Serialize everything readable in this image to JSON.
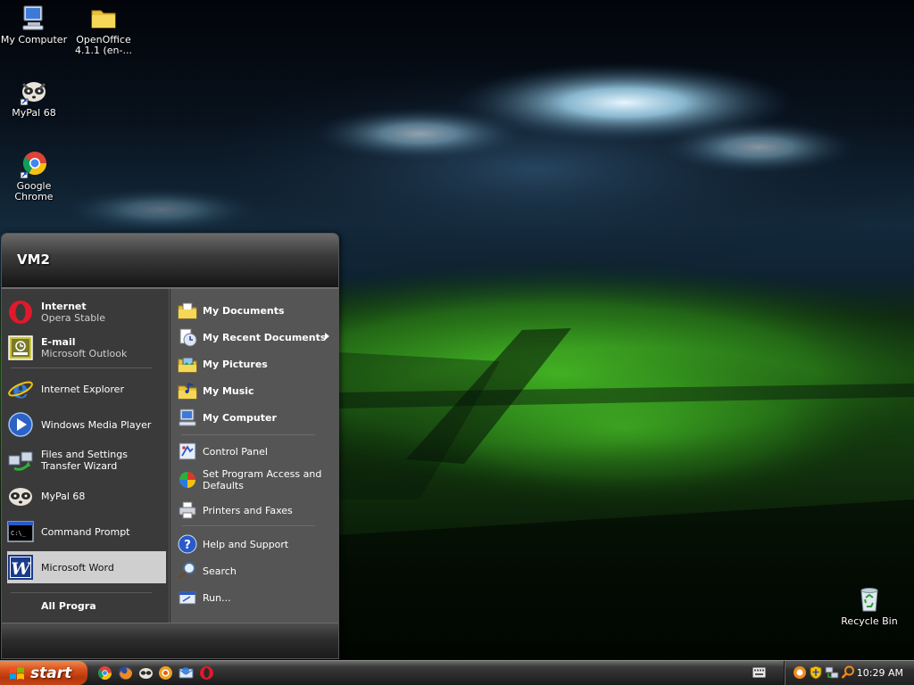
{
  "desktop": {
    "icons": [
      {
        "label": "My Computer",
        "icon": "my-computer-icon"
      },
      {
        "label": "OpenOffice 4.1.1 (en-...",
        "icon": "folder-icon"
      },
      {
        "label": "MyPal 68",
        "icon": "mypal-icon"
      },
      {
        "label": "Google Chrome",
        "icon": "chrome-icon"
      },
      {
        "label": "Recycle Bin",
        "icon": "recycle-bin-icon"
      }
    ]
  },
  "start_menu": {
    "user_name": "VM2",
    "pinned": [
      {
        "title": "Internet",
        "subtitle": "Opera Stable",
        "icon": "opera-icon"
      },
      {
        "title": "E-mail",
        "subtitle": "Microsoft Outlook",
        "icon": "outlook-icon"
      }
    ],
    "recent": [
      {
        "title": "Internet Explorer",
        "icon": "ie-icon"
      },
      {
        "title": "Windows Media Player",
        "icon": "media-player-icon"
      },
      {
        "title": "Files and Settings Transfer Wizard",
        "icon": "transfer-wizard-icon"
      },
      {
        "title": "MyPal 68",
        "icon": "mypal-icon"
      },
      {
        "title": "Command Prompt",
        "icon": "command-prompt-icon"
      },
      {
        "title": "Microsoft Word",
        "icon": "word-icon",
        "selected": true
      }
    ],
    "all_programs_label": "All Progra",
    "places": [
      {
        "label": "My Documents",
        "icon": "my-documents-icon"
      },
      {
        "label": "My Recent Documents",
        "icon": "recent-documents-icon",
        "has_submenu": true
      },
      {
        "label": "My Pictures",
        "icon": "my-pictures-icon"
      },
      {
        "label": "My Music",
        "icon": "my-music-icon"
      },
      {
        "label": "My Computer",
        "icon": "my-computer-icon"
      }
    ],
    "system": [
      {
        "label": "Control Panel",
        "icon": "control-panel-icon"
      },
      {
        "label": "Set Program Access and Defaults",
        "icon": "program-access-icon"
      },
      {
        "label": "Printers and Faxes",
        "icon": "printer-icon"
      }
    ],
    "help": [
      {
        "label": "Help and Support",
        "icon": "help-icon"
      },
      {
        "label": "Search",
        "icon": "search-icon"
      },
      {
        "label": "Run...",
        "icon": "run-icon"
      }
    ]
  },
  "taskbar": {
    "start_label": "start",
    "quick_launch": [
      "chrome-icon",
      "firefox-icon",
      "mypal-icon",
      "waterfox-icon",
      "thunderbird-icon",
      "opera-icon"
    ],
    "tray_icons": [
      "language-keyboard-icon",
      "avast-icon",
      "security-shield-icon",
      "network-icon",
      "search-tray-icon"
    ],
    "clock": "10:29 AM"
  },
  "colors": {
    "start_button": "#d9531e",
    "menu_left": "#3a3a3a",
    "menu_right": "#555555",
    "selected_item": "#cfcfcf"
  }
}
